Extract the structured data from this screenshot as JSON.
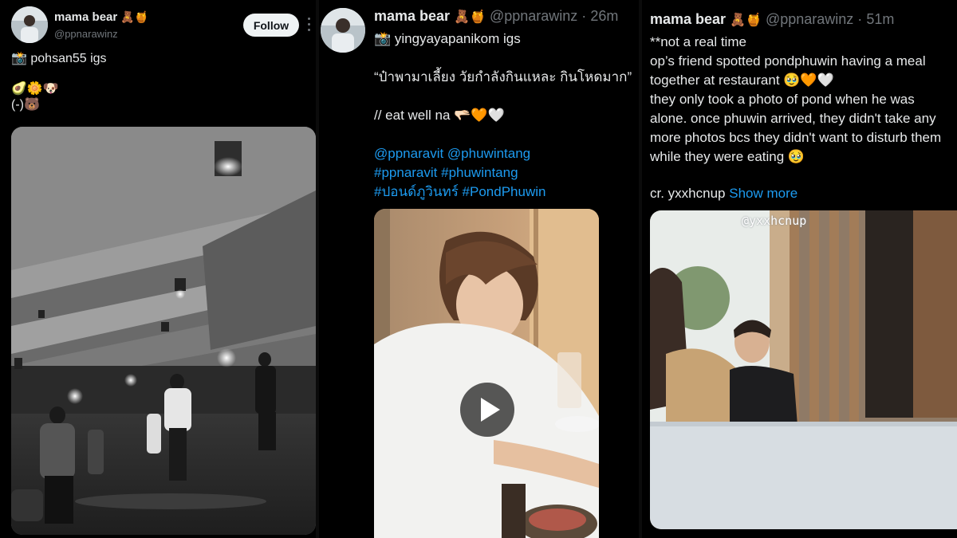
{
  "tweets": [
    {
      "author_name": "mama bear",
      "name_emoji": "🧸🍯",
      "handle": "@ppnarawinz",
      "follow_label": "Follow",
      "more_label": "⋮",
      "lines": [
        "📸 pohsan55 igs",
        "",
        "🥑🌼🐶",
        "(-)🐻"
      ],
      "media": "photo-dance-studio-black-white"
    },
    {
      "author_name": "mama bear",
      "name_emoji": "🧸🍯",
      "handle": "@ppnarawinz",
      "separator": "·",
      "time": "26m",
      "lines": [
        "📸  yingyayapanikom igs",
        "",
        "“ป๋าพามาเลี้ยง วัยกำลังกินแหละ กินโหดมาก”",
        "",
        "// eat well na 🫳🏻🧡🤍",
        ""
      ],
      "mentions": "@ppnaravit @phuwintang",
      "hashtags_1": "#ppnaravit #phuwintang",
      "hashtags_2": "#ปอนด์ภูวินทร์ #PondPhuwin",
      "media": "video-restaurant-meal",
      "play_icon": "play-icon"
    },
    {
      "author_name": "mama bear",
      "name_emoji": "🧸🍯",
      "handle": "@ppnarawinz",
      "separator": "·",
      "time": "51m",
      "lines": [
        "**not a real time",
        "op’s friend spotted pondphuwin having a meal",
        "together at restaurant 🥹🧡🤍",
        "they only took a photo of pond when he was",
        "alone. once phuwin arrived, they didn't take any",
        "more photos bcs they didn't want to disturb them",
        "while they were eating 🥹",
        ""
      ],
      "credit": "cr. yxxhcnup",
      "show_more": "Show more",
      "watermark": "@yxxhcnup",
      "media": "photo-restaurant-candid"
    }
  ],
  "colors": {
    "background": "#000000",
    "text": "#e7e9ea",
    "muted": "#71767b",
    "link": "#1d9bf0"
  }
}
